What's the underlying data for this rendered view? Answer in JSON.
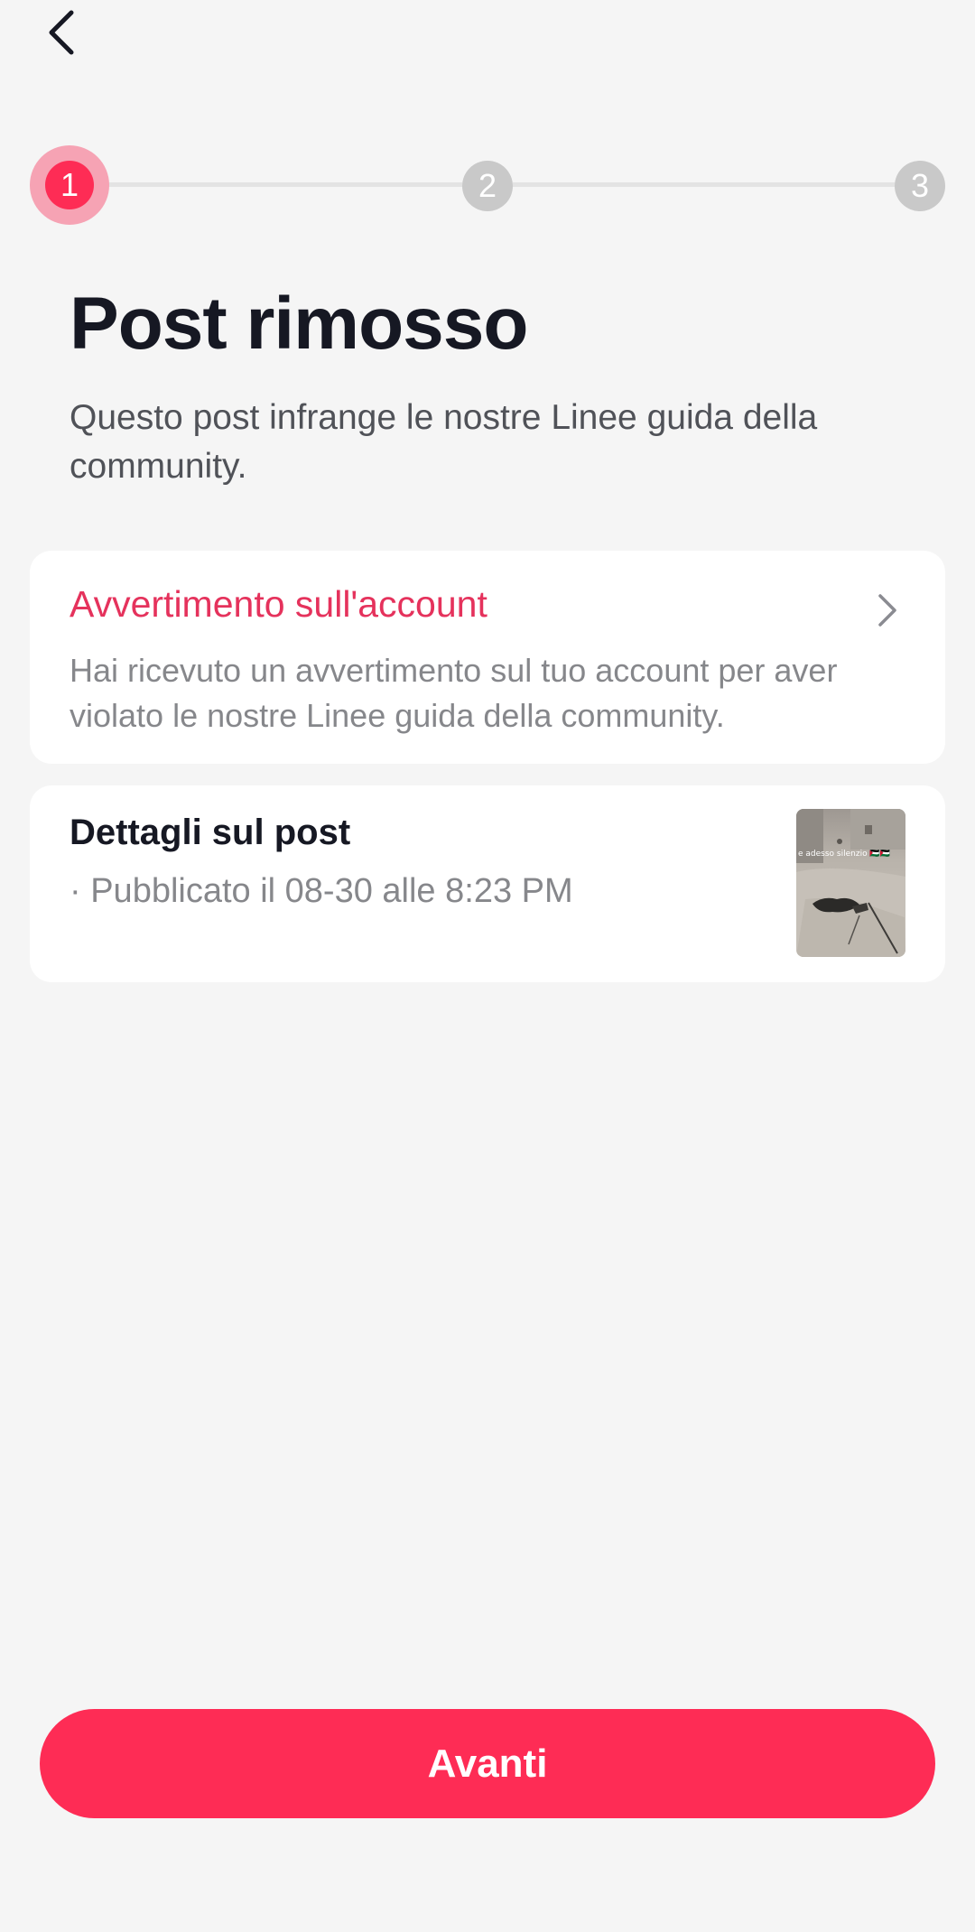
{
  "nav": {
    "back_icon": "chevron-left-icon"
  },
  "stepper": {
    "steps": [
      {
        "label": "1",
        "state": "active"
      },
      {
        "label": "2",
        "state": "inactive"
      },
      {
        "label": "3",
        "state": "inactive"
      }
    ],
    "current_step": 1
  },
  "header": {
    "title": "Post rimosso",
    "subtitle": "Questo post infrange le nostre Linee guida della community."
  },
  "warning_card": {
    "title": "Avvertimento sull'account",
    "description": "Hai ricevuto un avvertimento sul tuo account per aver violato le nostre Linee guida della community.",
    "icon": "chevron-right-icon"
  },
  "post_card": {
    "title": "Dettagli sul post",
    "published": "· Pubblicato il 08-30 alle 8:23 PM",
    "thumbnail_caption": "e adesso silenzio 🇵🇸🇵🇸"
  },
  "footer": {
    "next_label": "Avanti"
  },
  "colors": {
    "accent": "#fe2c55",
    "accent_text": "#e5325c",
    "background": "#f5f5f5",
    "card": "#ffffff",
    "inactive_step": "#c9c9c9"
  }
}
